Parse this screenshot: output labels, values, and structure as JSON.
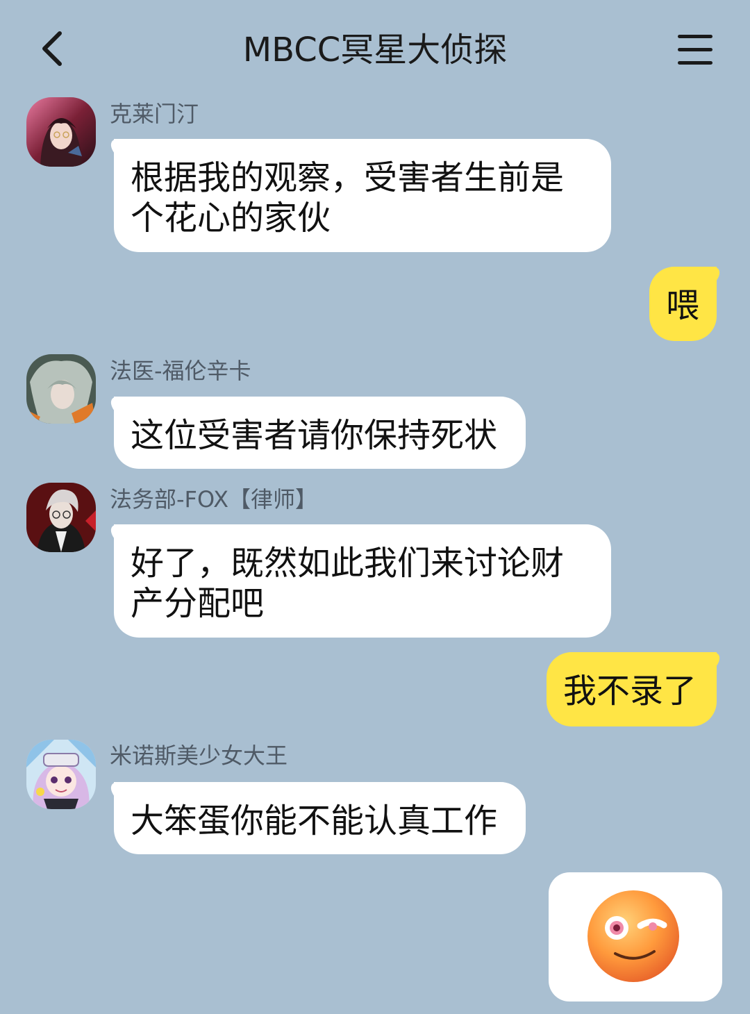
{
  "header": {
    "title": "MBCC冥星大侦探"
  },
  "messages": [
    {
      "sender": "克莱门汀",
      "lines": [
        "根据我的观察，受害者生前是",
        "个花心的家伙"
      ]
    },
    {
      "self": true,
      "lines": [
        "喂"
      ]
    },
    {
      "sender": "法医-福伦辛卡",
      "lines": [
        "这位受害者请你保持死状"
      ]
    },
    {
      "sender": "法务部-FOX【律师】",
      "lines": [
        "好了，既然如此我们来讨论财",
        "产分配吧"
      ]
    },
    {
      "self": true,
      "lines": [
        "我不录了"
      ]
    },
    {
      "sender": "米诺斯美少女大王",
      "lines": [
        "大笨蛋你能不能认真工作"
      ]
    },
    {
      "self": true,
      "sticker": "smirk-emoji"
    }
  ],
  "colors": {
    "background": "#a9bfd1",
    "incoming_bubble": "#ffffff",
    "outgoing_bubble": "#ffe545",
    "sender_name": "#4f5a66"
  }
}
